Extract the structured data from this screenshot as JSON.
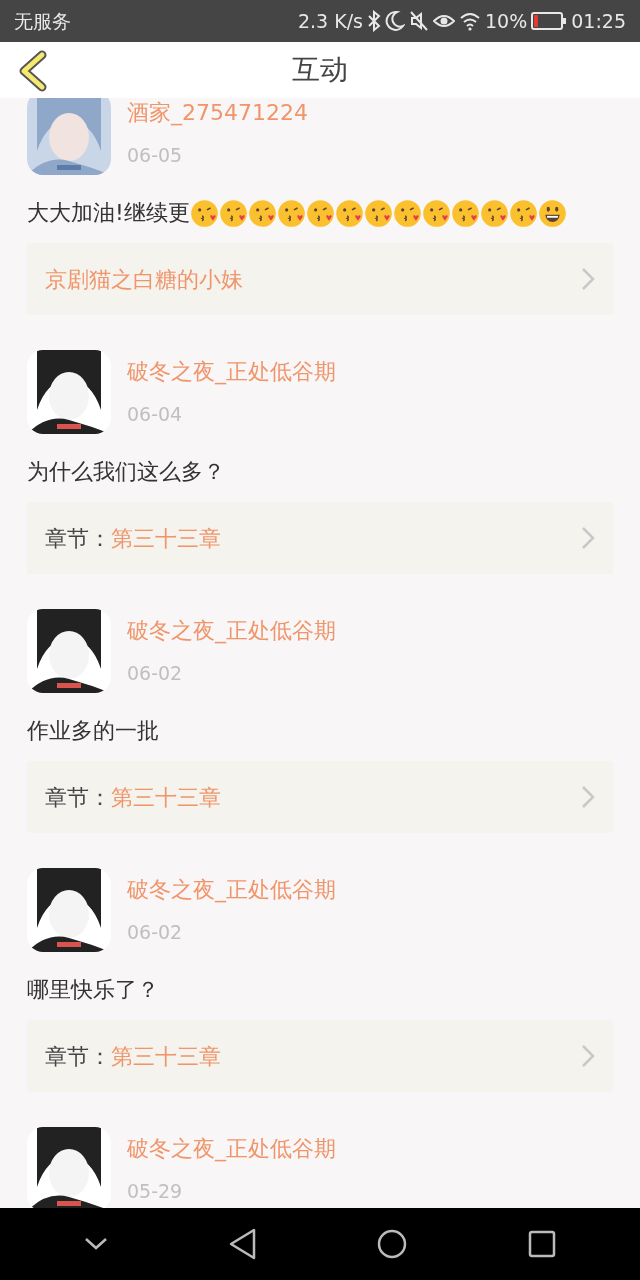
{
  "status_bar": {
    "carrier": "无服务",
    "speed": "2.3 K/s",
    "battery": "10%",
    "time": "01:25"
  },
  "header": {
    "title": "互动"
  },
  "comments": [
    {
      "user": "酒家_275471224",
      "date": "06-05",
      "text": "大大加油!继续更",
      "emojis": [
        {
          "kind": "kiss"
        },
        {
          "kind": "kiss"
        },
        {
          "kind": "kiss"
        },
        {
          "kind": "kiss"
        },
        {
          "kind": "kiss"
        },
        {
          "kind": "kiss"
        },
        {
          "kind": "kiss"
        },
        {
          "kind": "kiss"
        },
        {
          "kind": "kiss"
        },
        {
          "kind": "kiss"
        },
        {
          "kind": "kiss"
        },
        {
          "kind": "kiss"
        },
        {
          "kind": "smile"
        }
      ],
      "link": {
        "kind": "book",
        "value": "京剧猫之白糖的小妹"
      }
    },
    {
      "user": "破冬之夜_正处低谷期",
      "date": "06-04",
      "text": "为什么我们这么多？",
      "link": {
        "kind": "chapter",
        "label": "章节：",
        "value": "第三十三章"
      }
    },
    {
      "user": "破冬之夜_正处低谷期",
      "date": "06-02",
      "text": "作业多的一批",
      "link": {
        "kind": "chapter",
        "label": "章节：",
        "value": "第三十三章"
      }
    },
    {
      "user": "破冬之夜_正处低谷期",
      "date": "06-02",
      "text": "哪里快乐了？",
      "link": {
        "kind": "chapter",
        "label": "章节：",
        "value": "第三十三章"
      }
    },
    {
      "user": "破冬之夜_正处低谷期",
      "date": "05-29"
    }
  ]
}
